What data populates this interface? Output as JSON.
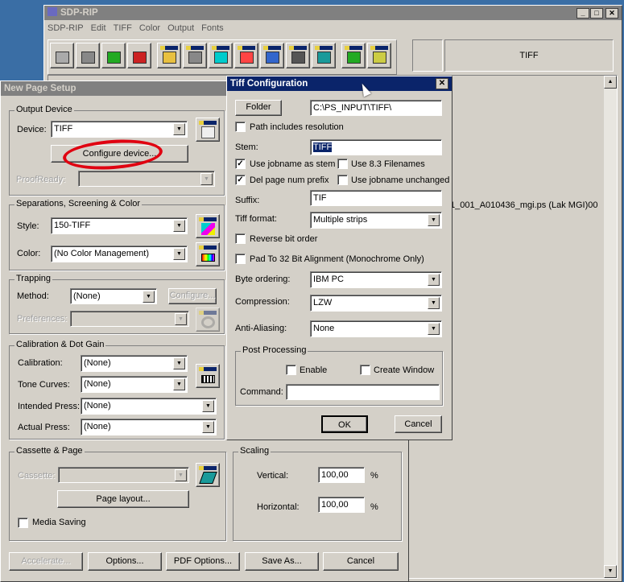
{
  "main_window": {
    "title": "SDP-RIP",
    "menu": [
      "SDP-RIP",
      "Edit",
      "TIFF",
      "Color",
      "Output",
      "Fonts"
    ],
    "status_device": "TIFF",
    "job_line": "5-001_001_A010436_mgi.ps (Lak MGI)00",
    "toolbar_icons": [
      "printer-icon",
      "printer-queue-icon",
      "start-green-icon",
      "stop-red-icon",
      "page-icon",
      "device-icon",
      "separations-icon",
      "color-icon",
      "trapping-icon",
      "calibration-icon",
      "cassette-icon",
      "output-arrow-icon",
      "layout-icon"
    ]
  },
  "page_setup": {
    "title": "New Page Setup",
    "output_device": {
      "label": "Output Device",
      "device_label": "Device:",
      "device_value": "TIFF",
      "configure": "Configure device...",
      "proofready_label": "ProofReady:"
    },
    "separations": {
      "label": "Separations, Screening & Color",
      "style_label": "Style:",
      "style_value": "150-TIFF",
      "color_label": "Color:",
      "color_value": "(No Color Management)"
    },
    "trapping": {
      "label": "Trapping",
      "method_label": "Method:",
      "method_value": "(None)",
      "configure": "Configure...",
      "preferences_label": "Preferences:"
    },
    "calibration": {
      "label": "Calibration & Dot Gain",
      "calibration_label": "Calibration:",
      "calibration_value": "(None)",
      "tone_label": "Tone Curves:",
      "tone_value": "(None)",
      "intended_label": "Intended Press:",
      "intended_value": "(None)",
      "actual_label": "Actual Press:",
      "actual_value": "(None)"
    },
    "cassette": {
      "label": "Cassette & Page",
      "cassette_label": "Cassette:",
      "page_layout": "Page layout...",
      "media_saving": "Media Saving"
    },
    "scaling": {
      "label": "Scaling",
      "vertical_label": "Vertical:",
      "vertical_value": "100,00",
      "horizontal_label": "Horizontal:",
      "horizontal_value": "100,00",
      "unit": "%"
    },
    "buttons": {
      "accelerate": "Accelerate...",
      "options": "Options...",
      "pdf_options": "PDF Options...",
      "save_as": "Save As...",
      "cancel": "Cancel"
    }
  },
  "tiff_config": {
    "title": "Tiff Configuration",
    "folder_button": "Folder",
    "folder_value": "C:\\PS_INPUT\\TIFF\\",
    "path_includes_resolution": "Path includes resolution",
    "stem_label": "Stem:",
    "stem_value": "TIFF",
    "use_jobname_as_stem": "Use jobname as stem",
    "use_83": "Use 8.3 Filenames",
    "del_page_num": "Del page num prefix",
    "use_jobname_unchanged": "Use jobname unchanged",
    "suffix_label": "Suffix:",
    "suffix_value": "TIF",
    "format_label": "Tiff format:",
    "format_value": "Multiple strips",
    "reverse_bit": "Reverse bit order",
    "pad32": "Pad To 32 Bit Alignment (Monochrome Only)",
    "byte_label": "Byte ordering:",
    "byte_value": "IBM PC",
    "compression_label": "Compression:",
    "compression_value": "LZW",
    "aa_label": "Anti-Aliasing:",
    "aa_value": "None",
    "post_label": "Post Processing",
    "enable": "Enable",
    "create_window": "Create Window",
    "command_label": "Command:",
    "command_value": "",
    "ok": "OK",
    "cancel": "Cancel"
  },
  "checks": {
    "use_jobname_as_stem": true,
    "del_page_num": true
  }
}
